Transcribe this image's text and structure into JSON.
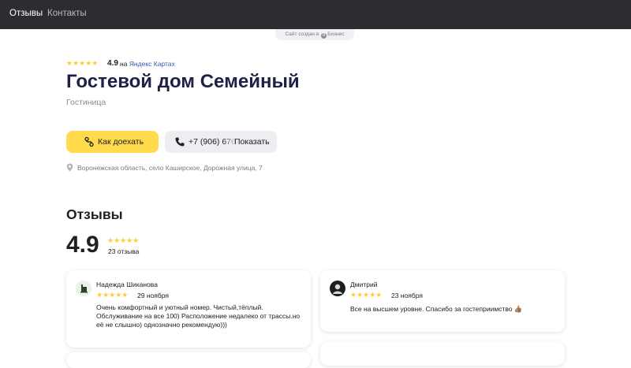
{
  "nav": {
    "reviews": "Отзывы",
    "contacts": "Контакты"
  },
  "made_with": {
    "prefix": "Сайт создан в",
    "brand": "Бизнес",
    "brand_mark": "Я"
  },
  "rating": {
    "stars": "★★★★★",
    "value": "4.9",
    "on": "на",
    "source": "Яндекс Картах"
  },
  "business": {
    "name": "Гостевой дом Семейный",
    "category": "Гостиница"
  },
  "actions": {
    "route_label": "Как доехать",
    "phone_number": "+7 (906) 676",
    "phone_show_label": "Показать"
  },
  "address": "Воронежская область, село Каширское, Дорожная улица, 7",
  "reviews": {
    "title": "Отзывы",
    "rating": "4.9",
    "stars": "★★★★★",
    "count": "23 отзыва",
    "items": [
      {
        "author": "Надежда Шиканова",
        "stars": "★★★★★",
        "date": "29 ноября",
        "text": [
          "Очень комфортный и уютный номер. Чистый,тёплый.",
          "Обслуживание на все 100) Расположение недалеко от трассы.но",
          "её не слышно) однозначно рекомендую)))"
        ]
      },
      {
        "author": "Дмитрий",
        "stars": "★★★★★",
        "date": "23 ноября",
        "text": [
          "Все на высшем уровне. Спасибо за гостеприимство 👍🏽"
        ]
      }
    ]
  },
  "colors": {
    "topbar": "#2b2d30",
    "star": "#ffcc33",
    "route_button": "#ffdb4d",
    "phone_button": "#eceef1",
    "title": "#1f2045",
    "link": "#2e5ca8"
  }
}
